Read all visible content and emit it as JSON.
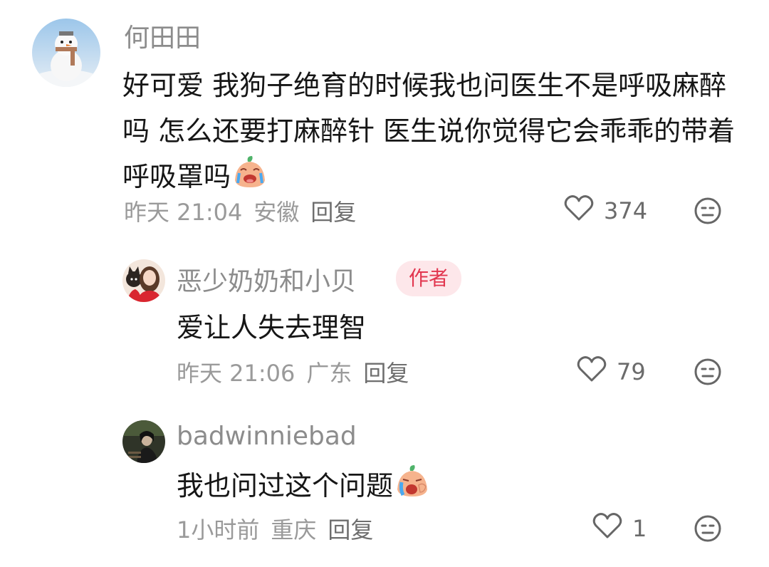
{
  "comments": [
    {
      "username": "何田田",
      "content": "好可爱 我狗子绝育的时候我也问医生不是呼吸麻醉吗 怎么还要打麻醉针 医生说你觉得它会乖乖的带着呼吸罩吗",
      "time": "昨天 21:04",
      "location": "安徽",
      "reply_label": "回复",
      "like_count": "374"
    },
    {
      "username": "恶少奶奶和小贝",
      "badge": "作者",
      "content": "爱让人失去理智",
      "time": "昨天 21:06",
      "location": "广东",
      "reply_label": "回复",
      "like_count": "79"
    },
    {
      "username": "badwinniebad",
      "content": "我也问过这个问题",
      "time": "1小时前",
      "location": "重庆",
      "reply_label": "回复",
      "like_count": "1"
    }
  ],
  "colors": {
    "username": "#8c8c8c",
    "content": "#161616",
    "meta": "#9a9a9a",
    "badge_bg": "#fde7ea",
    "badge_text": "#e2364f"
  },
  "icons": [
    "heart-outline-icon",
    "dislike-face-icon",
    "crying-face-emoji",
    "sobbing-face-emoji"
  ]
}
